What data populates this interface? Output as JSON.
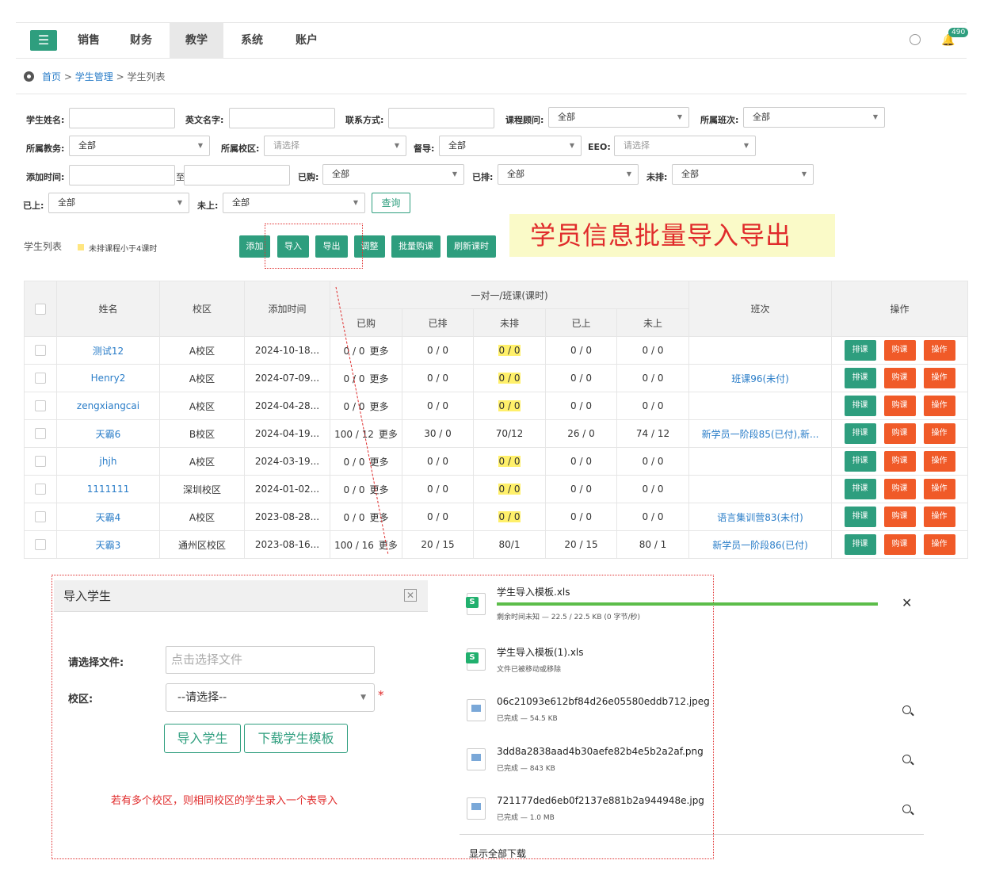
{
  "nav": {
    "menu_icon": "☰",
    "items": [
      "销售",
      "财务",
      "教学",
      "系统",
      "账户"
    ],
    "active": "教学",
    "notification_count": "490"
  },
  "breadcrumb": {
    "home": "首页",
    "sep": ">",
    "level2": "学生管理",
    "current": "学生列表"
  },
  "filters": {
    "student_name": "学生姓名:",
    "english_name": "英文名字:",
    "contact": "联系方式:",
    "course_advisor": {
      "label": "课程顾问:",
      "value": "全部"
    },
    "class_label": {
      "label": "所属班次:",
      "value": "全部"
    },
    "academic": {
      "label": "所属教务:",
      "value": "全部"
    },
    "campus": {
      "label": "所属校区:",
      "value": "请选择"
    },
    "supervisor": {
      "label": "督导:",
      "value": "全部"
    },
    "eeo": {
      "label": "EEO:",
      "value": "请选择"
    },
    "added_time": "添加时间:",
    "to": "至",
    "purchased": {
      "label": "已购:",
      "value": "全部"
    },
    "scheduled": {
      "label": "已排:",
      "value": "全部"
    },
    "unscheduled": {
      "label": "未排:",
      "value": "全部"
    },
    "attended": {
      "label": "已上:",
      "value": "全部"
    },
    "unattended": {
      "label": "未上:",
      "value": "全部"
    },
    "query_button": "查询"
  },
  "list": {
    "title": "学生列表",
    "legend": "未排课程小于4课时",
    "buttons": [
      "添加",
      "导入",
      "导出",
      "调整",
      "批量购课",
      "刷新课时"
    ],
    "banner": "学员信息批量导入导出"
  },
  "table": {
    "headers": {
      "name": "姓名",
      "campus": "校区",
      "added": "添加时间",
      "group": "一对一/班课(课时)",
      "purchased": "已购",
      "scheduled": "已排",
      "unscheduled": "未排",
      "attended": "已上",
      "unattended": "未上",
      "class": "班次",
      "ops": "操作"
    },
    "more_label": "更多",
    "action_labels": [
      "排课",
      "购课",
      "操作"
    ],
    "rows": [
      {
        "name": "测试12",
        "campus": "A校区",
        "added": "2024-10-18...",
        "purchased": "0 / 0",
        "scheduled": "0 / 0",
        "unscheduled": "0 / 0",
        "unscheduled_highlight": true,
        "attended": "0 / 0",
        "unattended": "0 / 0",
        "class": ""
      },
      {
        "name": "Henry2",
        "campus": "A校区",
        "added": "2024-07-09...",
        "purchased": "0 / 0",
        "scheduled": "0 / 0",
        "unscheduled": "0 / 0",
        "unscheduled_highlight": true,
        "attended": "0 / 0",
        "unattended": "0 / 0",
        "class": "班课96(未付)"
      },
      {
        "name": "zengxiangcai",
        "campus": "A校区",
        "added": "2024-04-28...",
        "purchased": "0 / 0",
        "scheduled": "0 / 0",
        "unscheduled": "0 / 0",
        "unscheduled_highlight": true,
        "attended": "0 / 0",
        "unattended": "0 / 0",
        "class": ""
      },
      {
        "name": "天霸6",
        "campus": "B校区",
        "added": "2024-04-19...",
        "purchased": "100 / 12",
        "scheduled": "30 / 0",
        "unscheduled": "70/12",
        "unscheduled_highlight": false,
        "attended": "26 / 0",
        "unattended": "74 / 12",
        "class": "新学员一阶段85(已付),新..."
      },
      {
        "name": "jhjh",
        "campus": "A校区",
        "added": "2024-03-19...",
        "purchased": "0 / 0",
        "scheduled": "0 / 0",
        "unscheduled": "0 / 0",
        "unscheduled_highlight": true,
        "attended": "0 / 0",
        "unattended": "0 / 0",
        "class": ""
      },
      {
        "name": "1111111",
        "campus": "深圳校区",
        "added": "2024-01-02...",
        "purchased": "0 / 0",
        "scheduled": "0 / 0",
        "unscheduled": "0 / 0",
        "unscheduled_highlight": true,
        "attended": "0 / 0",
        "unattended": "0 / 0",
        "class": ""
      },
      {
        "name": "天霸4",
        "campus": "A校区",
        "added": "2023-08-28...",
        "purchased": "0 / 0",
        "scheduled": "0 / 0",
        "unscheduled": "0 / 0",
        "unscheduled_highlight": true,
        "attended": "0 / 0",
        "unattended": "0 / 0",
        "class": "语言集训营83(未付)"
      },
      {
        "name": "天霸3",
        "campus": "通州区校区",
        "added": "2023-08-16...",
        "purchased": "100 / 16",
        "scheduled": "20 / 15",
        "unscheduled": "80/1",
        "unscheduled_highlight": false,
        "attended": "20 / 15",
        "unattended": "80 / 1",
        "class": "新学员一阶段86(已付)"
      }
    ]
  },
  "import_dialog": {
    "title": "导入学生",
    "close_icon": "✕",
    "file_label": "请选择文件:",
    "file_placeholder": "点击选择文件",
    "campus_label": "校区:",
    "campus_value": "--请选择--",
    "required": "*",
    "import_button": "导入学生",
    "download_button": "下载学生模板",
    "hint": "若有多个校区，则相同校区的学生录入一个表导入"
  },
  "downloads": {
    "items": [
      {
        "name": "学生导入模板.xls",
        "meta": "剩余时间未知 — 22.5 / 22.5 KB (0 字节/秒)",
        "type": "xls",
        "progress": 1.0
      },
      {
        "name": "学生导入模板(1).xls",
        "meta": "文件已被移动或移除",
        "type": "xls"
      },
      {
        "name": "06c21093e612bf84d26e05580eddb712.jpeg",
        "meta": "已完成 — 54.5 KB",
        "type": "img"
      },
      {
        "name": "3dd8a2838aad4b30aefe82b4e5b2a2af.png",
        "meta": "已完成 — 843 KB",
        "type": "img"
      },
      {
        "name": "721177ded6eb0f2137e881b2a944948e.jpg",
        "meta": "已完成 — 1.0 MB",
        "type": "img"
      }
    ],
    "cancel_icon": "✕",
    "show_all": "显示全部下载"
  },
  "colors": {
    "primary": "#2e9e7e",
    "danger": "#f05a28",
    "link": "#2a7dc8",
    "annotation": "#e02b2b"
  }
}
